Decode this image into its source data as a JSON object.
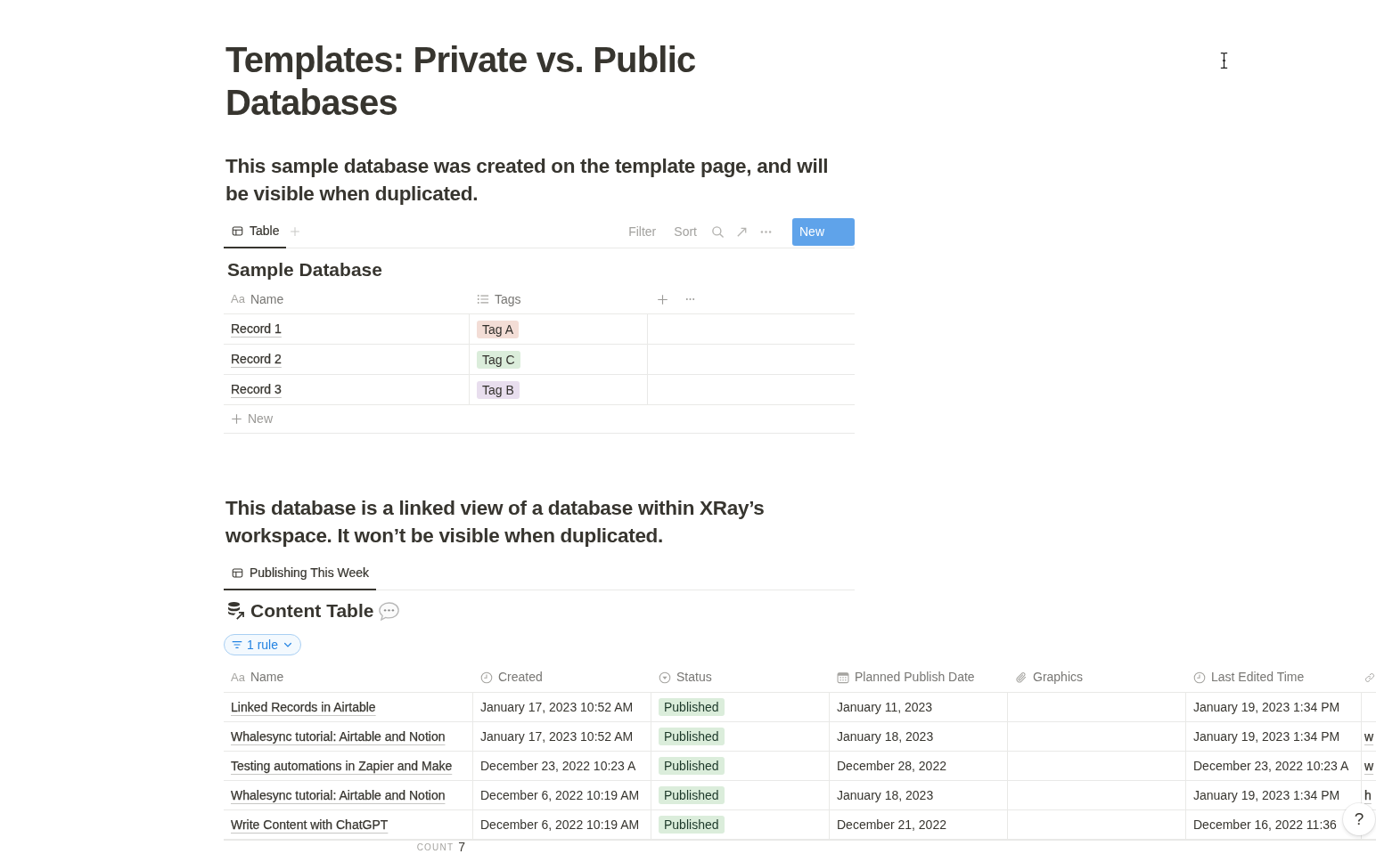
{
  "title": "Templates: Private vs. Public Databases",
  "sections": [
    {
      "kind": "source_database",
      "heading": "This sample database was created on the template page, and will be visible when duplicated.",
      "view_tabs": [
        {
          "label": "Table",
          "selected": true
        }
      ],
      "toolbar": {
        "buttons": [
          "Filter",
          "Sort"
        ],
        "new_button": "New"
      },
      "database_title": "Sample Database",
      "table": {
        "columns": [
          {
            "kind": "title",
            "glyph": "Aa",
            "label": "Name"
          },
          {
            "kind": "multi_select",
            "label": "Tags"
          }
        ],
        "rows": [
          {
            "name": "Record 1",
            "tags": [
              {
                "label": "Tag A",
                "color": "#f3ddd6"
              }
            ]
          },
          {
            "name": "Record 2",
            "tags": [
              {
                "label": "Tag C",
                "color": "#dbeddb"
              }
            ]
          },
          {
            "name": "Record 3",
            "tags": [
              {
                "label": "Tag B",
                "color": "#e8deee"
              }
            ]
          }
        ],
        "new_row": "New"
      }
    },
    {
      "kind": "linked_view",
      "heading": "This database is a linked view of a database within XRay’s workspace. It won’t be visible when duplicated.",
      "view_tabs": [
        {
          "label": "Publishing This Week",
          "selected": true
        }
      ],
      "database_title": "Content Table",
      "filter_pill": "1 rule",
      "table": {
        "columns": [
          {
            "kind": "title",
            "glyph": "Aa",
            "label": "Name"
          },
          {
            "kind": "created_time",
            "label": "Created"
          },
          {
            "kind": "status",
            "label": "Status"
          },
          {
            "kind": "date",
            "label": "Planned Publish Date"
          },
          {
            "kind": "files",
            "label": "Graphics"
          },
          {
            "kind": "last_edited_time",
            "label": "Last Edited Time"
          },
          {
            "kind": "url"
          }
        ],
        "rows": [
          {
            "name": "Linked Records in Airtable",
            "created": "January 17, 2023 10:52 AM",
            "status": "Published",
            "planned_publish_date": "January 11, 2023",
            "last_edited_time": "January 19, 2023 1:34 PM"
          },
          {
            "name": "Whalesync tutorial: Airtable and Notion",
            "created": "January 17, 2023 10:52 AM",
            "status": "Published",
            "planned_publish_date": "January 18, 2023",
            "last_edited_time": "January 19, 2023 1:34 PM",
            "column_7": "w"
          },
          {
            "name": "Testing automations in Zapier and Make",
            "created": "December 23, 2022 10:23 A",
            "status": "Published",
            "planned_publish_date": "December 28, 2022",
            "last_edited_time": "December 23, 2022 10:23 A",
            "column_7": "w"
          },
          {
            "name": "Whalesync tutorial: Airtable and Notion",
            "created": "December 6, 2022 10:19 AM",
            "status": "Published",
            "planned_publish_date": "January 18, 2023",
            "last_edited_time": "January 19, 2023 1:34 PM",
            "column_7": "h"
          },
          {
            "name": "Write Content with ChatGPT",
            "created": "December 6, 2022 10:19 AM",
            "status": "Published",
            "planned_publish_date": "December 21, 2022",
            "last_edited_time": "December 16, 2022 11:36"
          }
        ],
        "count": {
          "label": "COUNT",
          "value": "7"
        }
      }
    }
  ],
  "help_button": "?"
}
